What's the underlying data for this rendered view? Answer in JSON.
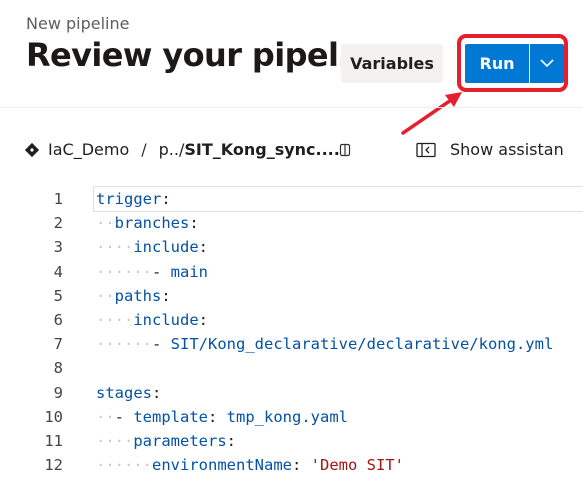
{
  "header": {
    "subtitle": "New pipeline",
    "title": "Review your pipel…",
    "variables_label": "Variables",
    "run_label": "Run"
  },
  "breadcrumb": {
    "repo": "IaC_Demo",
    "separator": "/",
    "path_prefix": "p../",
    "file": "SIT_Kong_sync...."
  },
  "assistant_label": "Show assistan",
  "colors": {
    "accent": "#0078d4",
    "highlight": "#e5202e"
  },
  "editor": {
    "line_numbers": [
      "1",
      "2",
      "3",
      "4",
      "5",
      "6",
      "7",
      "8",
      "9",
      "10",
      "11",
      "12"
    ],
    "lines": [
      [
        {
          "t": "trigger",
          "c": "key"
        },
        {
          "t": ":",
          "c": "punct"
        }
      ],
      [
        {
          "t": "··",
          "c": "ws"
        },
        {
          "t": "branches",
          "c": "key"
        },
        {
          "t": ":",
          "c": "punct"
        }
      ],
      [
        {
          "t": "····",
          "c": "ws"
        },
        {
          "t": "include",
          "c": "key"
        },
        {
          "t": ":",
          "c": "punct"
        }
      ],
      [
        {
          "t": "······",
          "c": "ws"
        },
        {
          "t": "- ",
          "c": "punct"
        },
        {
          "t": "main",
          "c": "val"
        }
      ],
      [
        {
          "t": "··",
          "c": "ws"
        },
        {
          "t": "paths",
          "c": "key"
        },
        {
          "t": ":",
          "c": "punct"
        }
      ],
      [
        {
          "t": "····",
          "c": "ws"
        },
        {
          "t": "include",
          "c": "key"
        },
        {
          "t": ":",
          "c": "punct"
        }
      ],
      [
        {
          "t": "······",
          "c": "ws"
        },
        {
          "t": "- ",
          "c": "punct"
        },
        {
          "t": "SIT/Kong_declarative/declarative/kong.yml",
          "c": "val"
        }
      ],
      [],
      [
        {
          "t": "stages",
          "c": "key"
        },
        {
          "t": ":",
          "c": "punct"
        }
      ],
      [
        {
          "t": "··",
          "c": "ws"
        },
        {
          "t": "- ",
          "c": "punct"
        },
        {
          "t": "template",
          "c": "key"
        },
        {
          "t": ": ",
          "c": "punct"
        },
        {
          "t": "tmp_kong.yaml",
          "c": "val"
        }
      ],
      [
        {
          "t": "····",
          "c": "ws"
        },
        {
          "t": "parameters",
          "c": "key"
        },
        {
          "t": ":",
          "c": "punct"
        }
      ],
      [
        {
          "t": "······",
          "c": "ws"
        },
        {
          "t": "environmentName",
          "c": "key"
        },
        {
          "t": ": ",
          "c": "punct"
        },
        {
          "t": "'Demo SIT'",
          "c": "str"
        }
      ]
    ]
  }
}
